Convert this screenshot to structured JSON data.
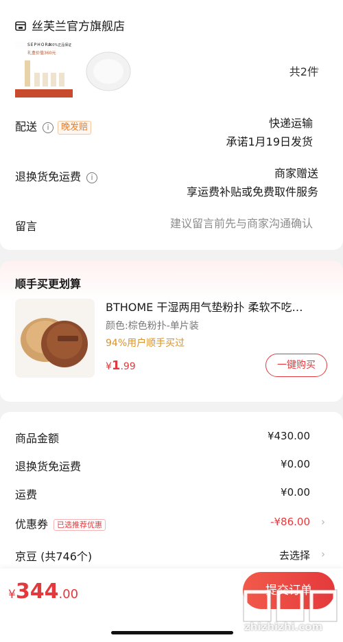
{
  "store": {
    "name": "丝芙兰官方旗舰店",
    "icon": "store-icon"
  },
  "product_bundle": {
    "count_label": "共",
    "count": "2",
    "unit": "件",
    "image_brand": "SEPHORA",
    "image_badge": "100%正品保证",
    "image_caption": "礼盒价值360元"
  },
  "delivery": {
    "label": "配送",
    "tag": "晚发赔",
    "method": "快递运输",
    "promise": "承诺1月19日发货"
  },
  "returns": {
    "label": "退换货免运费",
    "primary": "商家赠送",
    "secondary": "享运费补贴或免费取件服务"
  },
  "note": {
    "label": "留言",
    "placeholder": "建议留言前先与商家沟通确认"
  },
  "upsell": {
    "title": "顺手买更划算",
    "product_name": "BTHOME 干湿两用气垫粉扑 柔软不吃…",
    "spec": "颜色:棕色粉扑-单片装",
    "social_proof": "94%用户顺手买过",
    "price_currency": "¥",
    "price_int": "1",
    "price_dec": ".99",
    "buy_button": "一键购买"
  },
  "summary": {
    "goods_label": "商品金额",
    "goods_value": "¥430.00",
    "return_fee_label": "退换货免运费",
    "return_fee_value": "¥0.00",
    "shipping_label": "运费",
    "shipping_value": "¥0.00",
    "coupon_label": "优惠券",
    "coupon_tag": "已选推荐优惠",
    "coupon_value": "-¥86.00",
    "beans_label": "京豆 (共746个)",
    "beans_action": "去选择"
  },
  "footer": {
    "currency": "¥",
    "total_int": "344",
    "total_dec": ".00",
    "submit": "提交订单"
  },
  "watermark": {
    "logo": "值 值 值",
    "domain": "zhizhizhi.com"
  },
  "colors": {
    "accent": "#e4393c",
    "orange": "#e77d2b",
    "gold": "#d7932f"
  }
}
